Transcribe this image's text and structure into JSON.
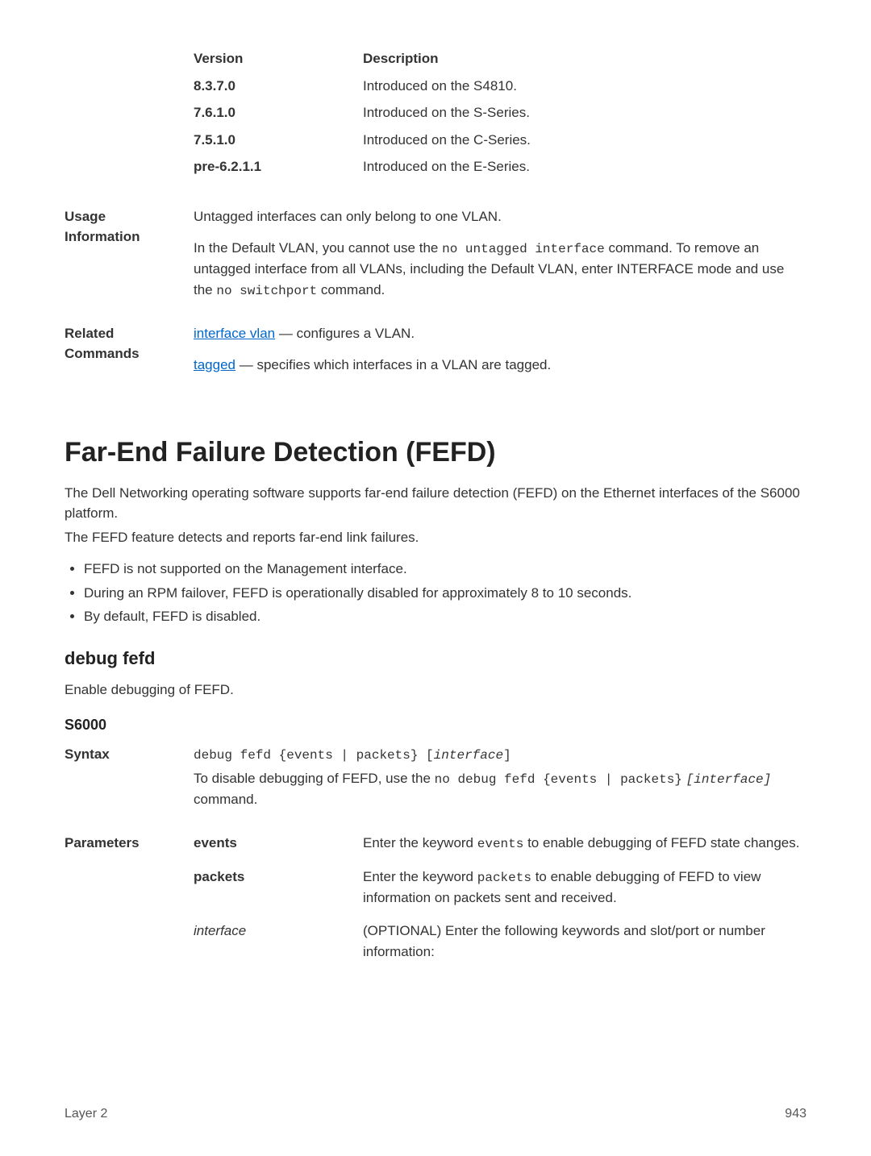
{
  "version_table": {
    "headers": {
      "col1": "Version",
      "col2": "Description"
    },
    "rows": [
      {
        "ver": "8.3.7.0",
        "desc": "Introduced on the S4810."
      },
      {
        "ver": "7.6.1.0",
        "desc": "Introduced on the S-Series."
      },
      {
        "ver": "7.5.1.0",
        "desc": "Introduced on the C-Series."
      },
      {
        "ver": "pre-6.2.1.1",
        "desc": "Introduced on the E-Series."
      }
    ]
  },
  "usage": {
    "label": "Usage Information",
    "p1": "Untagged interfaces can only belong to one VLAN.",
    "p2a": "In the Default VLAN, you cannot use the ",
    "p2_code1": "no untagged interface",
    "p2b": " command. To remove an untagged interface from all VLANs, including the Default VLAN, enter INTERFACE mode and use the ",
    "p2_code2": "no switchport",
    "p2c": " command."
  },
  "related": {
    "label": "Related Commands",
    "link1": "interface vlan",
    "link1_desc": " — configures a VLAN.",
    "link2": "tagged",
    "link2_desc": " — specifies which interfaces in a VLAN are tagged."
  },
  "fefd": {
    "heading": "Far-End Failure Detection (FEFD)",
    "intro1": "The Dell Networking operating software supports far-end failure detection (FEFD) on the Ethernet interfaces of the S6000 platform.",
    "intro2": "The FEFD feature detects and reports far-end link failures.",
    "bullets": [
      "FEFD is not supported on the Management interface.",
      "During an RPM failover, FEFD is operationally disabled for approximately 8 to 10 seconds.",
      "By default, FEFD is disabled."
    ]
  },
  "debug": {
    "heading": "debug fefd",
    "desc": "Enable debugging of FEFD.",
    "platform": "S6000",
    "syntax_label": "Syntax",
    "syntax_cmd_a": "debug fefd {events | packets} [",
    "syntax_cmd_iface": "interface",
    "syntax_cmd_b": "]",
    "disable_a": "To disable debugging of FEFD, use the ",
    "disable_code": "no debug fefd {events | packets}",
    "disable_b": " ",
    "disable_iface": "[interface]",
    "disable_c": " command.",
    "params_label": "Parameters",
    "params": [
      {
        "name": "events",
        "name_class": "bold",
        "desc_a": "Enter the keyword ",
        "desc_code": "events",
        "desc_b": " to enable debugging of FEFD state changes."
      },
      {
        "name": "packets",
        "name_class": "bold",
        "desc_a": "Enter the keyword ",
        "desc_code": "packets",
        "desc_b": " to enable debugging of FEFD to view information on packets sent and received."
      },
      {
        "name": "interface",
        "name_class": "italic",
        "desc_a": "(OPTIONAL) Enter the following keywords and slot/port or number information:",
        "desc_code": "",
        "desc_b": ""
      }
    ]
  },
  "footer": {
    "left": "Layer 2",
    "right": "943"
  }
}
